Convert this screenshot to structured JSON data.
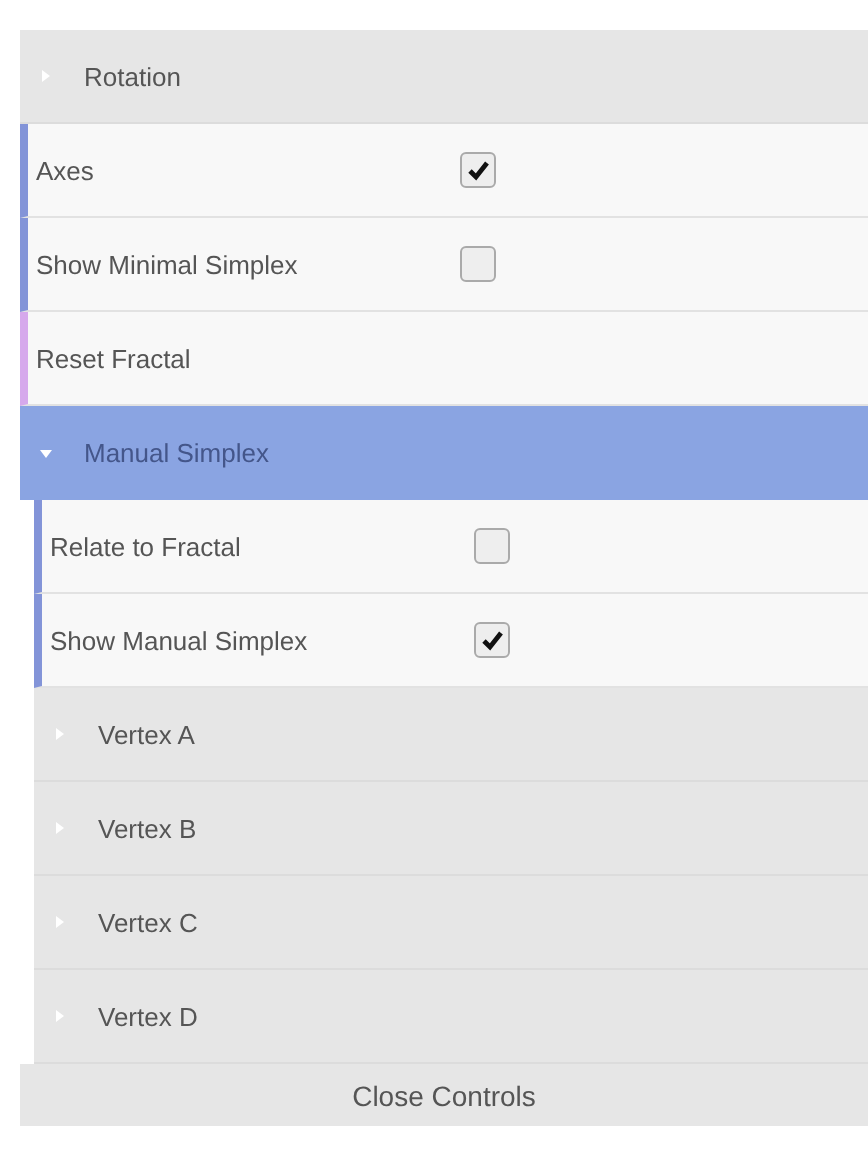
{
  "controls": [
    {
      "kind": "folder",
      "label": "Rotation",
      "expanded": false
    },
    {
      "kind": "checkbox",
      "label": "Axes",
      "checked": true
    },
    {
      "kind": "checkbox",
      "label": "Show Minimal Simplex",
      "checked": false
    },
    {
      "kind": "button",
      "label": "Reset Fractal"
    },
    {
      "kind": "folder",
      "label": "Manual Simplex",
      "expanded": true,
      "children": [
        {
          "kind": "checkbox",
          "label": "Relate to Fractal",
          "checked": false
        },
        {
          "kind": "checkbox",
          "label": "Show Manual Simplex",
          "checked": true
        },
        {
          "kind": "folder",
          "label": "Vertex A",
          "expanded": false
        },
        {
          "kind": "folder",
          "label": "Vertex B",
          "expanded": false
        },
        {
          "kind": "folder",
          "label": "Vertex C",
          "expanded": false
        },
        {
          "kind": "folder",
          "label": "Vertex D",
          "expanded": false
        }
      ]
    }
  ],
  "close_button": "Close Controls"
}
